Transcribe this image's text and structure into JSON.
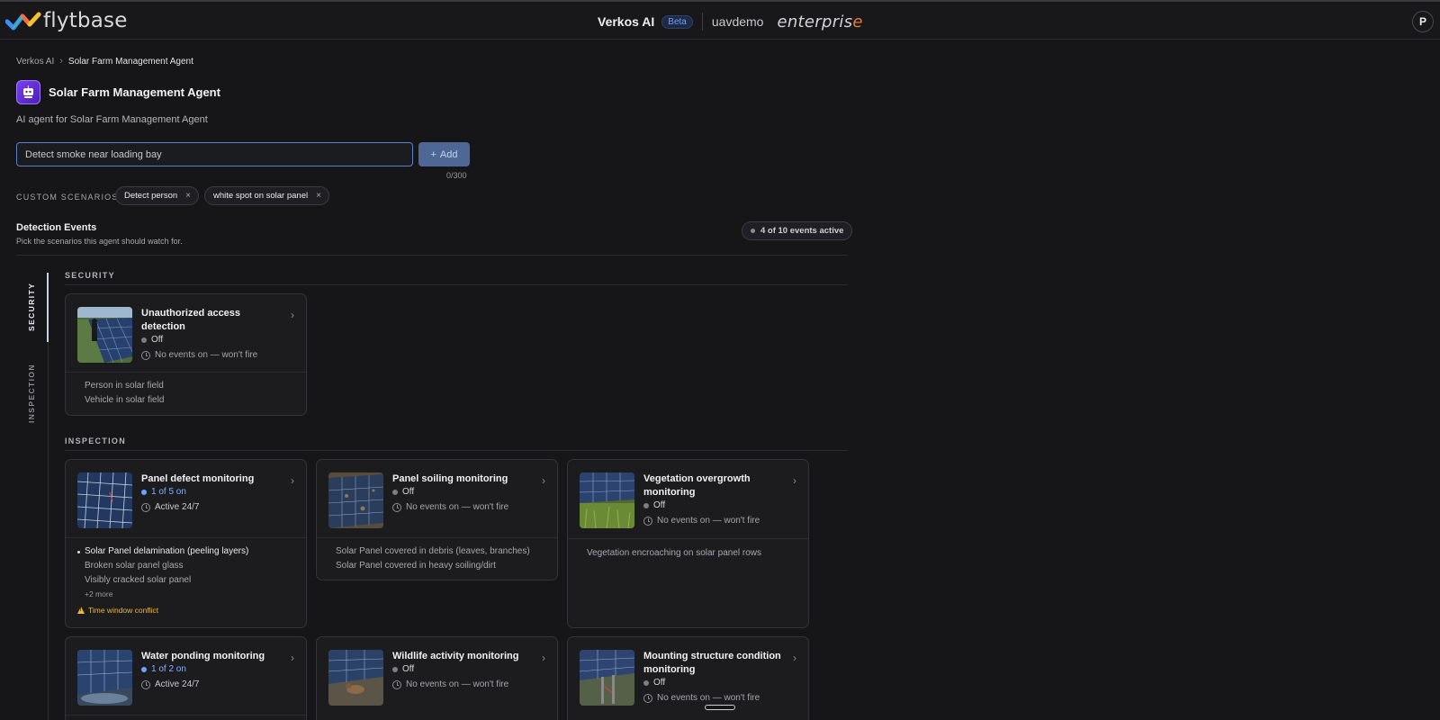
{
  "topbar": {
    "logo_text": "flytbase",
    "app_name": "Verkos AI",
    "beta_label": "Beta",
    "org_name": "uavdemo",
    "plan_label": "enterpris",
    "plan_label_accent": "e",
    "avatar_initial": "P"
  },
  "breadcrumb": {
    "root": "Verkos AI",
    "current": "Solar Farm Management Agent"
  },
  "agent": {
    "title": "Solar Farm Management Agent",
    "subtitle": "AI agent for Solar Farm Management Agent",
    "icon": "agent-bot-icon"
  },
  "scenario_input": {
    "value": "Detect smoke near loading bay",
    "add_label": "Add",
    "char_count": "0/300"
  },
  "custom_scenarios": {
    "label": "CUSTOM SCENARIOS",
    "chips": [
      {
        "label": "Detect person"
      },
      {
        "label": "white spot on solar panel"
      }
    ],
    "remove_glyph": "×"
  },
  "detection_events": {
    "title": "Detection Events",
    "subtitle": "Pick the scenarios this agent should watch for.",
    "active_summary": "4 of 10 events active"
  },
  "tabs": [
    {
      "label": "SECURITY",
      "active": true
    },
    {
      "label": "INSPECTION",
      "active": false
    }
  ],
  "sections": [
    {
      "label": "SECURITY",
      "cards": [
        {
          "title": "Unauthorized access detection",
          "status": "Off",
          "schedule": "No events on — won't fire",
          "events": [
            "Person in solar field",
            "Vehicle in solar field"
          ]
        }
      ]
    },
    {
      "label": "INSPECTION",
      "cards": [
        {
          "title": "Panel defect monitoring",
          "status": "1 of 5 on",
          "schedule": "Active 24/7",
          "events": [
            "Solar Panel delamination (peeling layers)",
            "Broken solar panel glass",
            "Visibly cracked solar panel"
          ],
          "more": "+2 more",
          "warning": "Time window conflict"
        },
        {
          "title": "Panel soiling monitoring",
          "status": "Off",
          "schedule": "No events on — won't fire",
          "events": [
            "Solar Panel covered in debris (leaves, branches)",
            "Solar Panel covered in heavy soiling/dirt"
          ]
        },
        {
          "title": "Vegetation overgrowth monitoring",
          "status": "Off",
          "schedule": "No events on — won't fire",
          "events": [
            "Vegetation encroaching on solar panel rows"
          ]
        },
        {
          "title": "Water ponding monitoring",
          "status": "1 of 2 on",
          "schedule": "Active 24/7"
        },
        {
          "title": "Wildlife activity monitoring",
          "status": "Off",
          "schedule": "No events on — won't fire"
        },
        {
          "title": "Mounting structure condition monitoring",
          "status": "Off",
          "schedule": "No events on — won't fire"
        }
      ]
    }
  ],
  "colors": {
    "accent_blue": "#5a82c8",
    "status_on": "#6ea2ff",
    "status_off": "#7d7d83",
    "warning": "#e8b83a",
    "agent_icon": "#6a32e6"
  }
}
